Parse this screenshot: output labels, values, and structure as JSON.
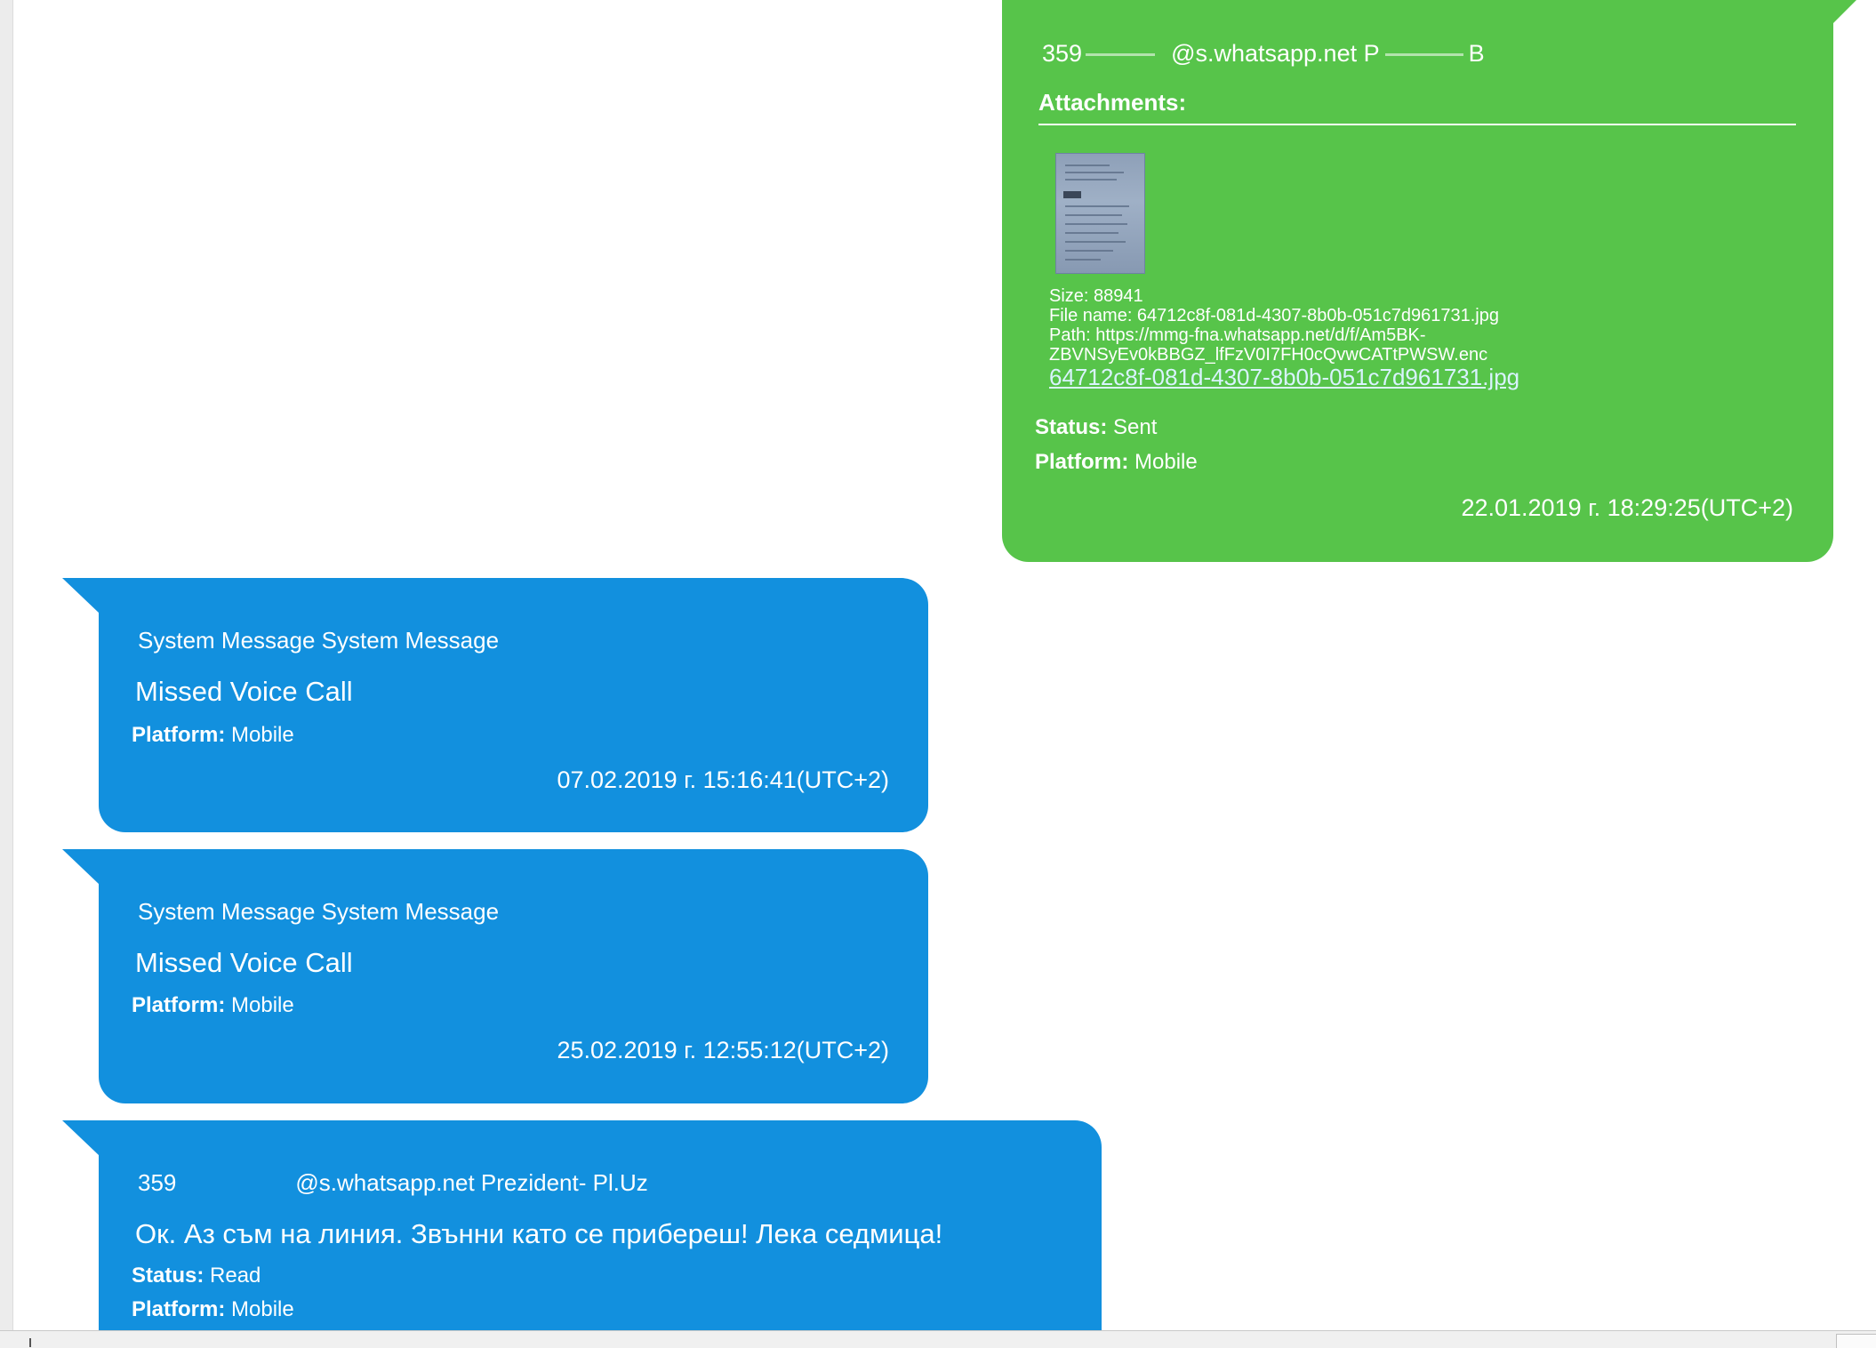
{
  "messages": [
    {
      "direction": "outgoing",
      "sender_prefix": "359",
      "sender_suffix": "@s.whatsapp.net P",
      "sender_tail": "B",
      "attachments_label": "Attachments:",
      "attachment": {
        "size": "Size: 88941",
        "file_name": "File name: 64712c8f-081d-4307-8b0b-051c7d961731.jpg",
        "path_line1": "Path: https://mmg-fna.whatsapp.net/d/f/Am5BK-",
        "path_line2": "ZBVNSyEv0kBBGZ_lfFzV0I7FH0cQvwCATtPWSW.enc",
        "link": "64712c8f-081d-4307-8b0b-051c7d961731.jpg"
      },
      "status_label": "Status:",
      "status_value": "Sent",
      "platform_label": "Platform:",
      "platform_value": "Mobile",
      "timestamp": "22.01.2019 г. 18:29:25(UTC+2)"
    },
    {
      "direction": "incoming",
      "sender": "System Message System Message",
      "body": "Missed Voice Call",
      "platform_label": "Platform:",
      "platform_value": "Mobile",
      "timestamp": "07.02.2019 г. 15:16:41(UTC+2)"
    },
    {
      "direction": "incoming",
      "sender": "System Message System Message",
      "body": "Missed Voice Call",
      "platform_label": "Platform:",
      "platform_value": "Mobile",
      "timestamp": "25.02.2019 г. 12:55:12(UTC+2)"
    },
    {
      "direction": "incoming",
      "sender_prefix": "359",
      "sender_suffix": "@s.whatsapp.net Prezident- Pl.Uz",
      "body": "Ок. Аз съм на линия. Звънни като се прибереш! Лека седмица!",
      "status_label": "Status:",
      "status_value": "Read",
      "platform_label": "Platform:",
      "platform_value": "Mobile"
    }
  ],
  "colors": {
    "outgoing_bubble": "#57c44a",
    "incoming_bubble": "#1290de",
    "text": "#ffffff"
  }
}
